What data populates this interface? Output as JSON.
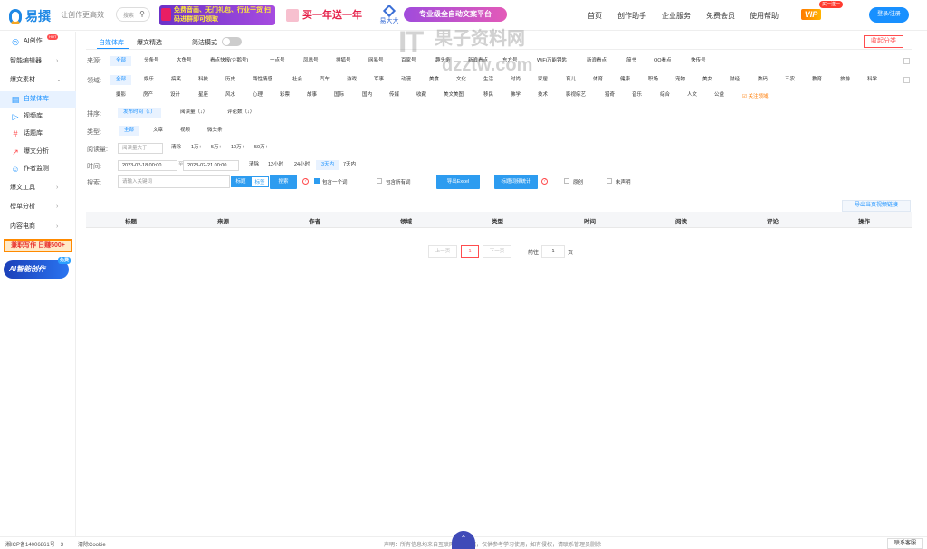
{
  "header": {
    "logo_text": "易撰",
    "slogan": "让创作更高效",
    "search_placeholder": "搜索",
    "ad_banner_1": "免费音画、无门礼包、行业干货 扫码进群即可领取",
    "ad_banner_2": "买一年送一年",
    "ad_banner_3": "易大大",
    "ad_banner_4": "专业级全自动文案平台",
    "nav": [
      "首页",
      "创作助手",
      "企业服务",
      "免费会员",
      "使用帮助"
    ],
    "vip_label": "VIP",
    "vip_badge": "买一送一",
    "login_label": "登录/注册"
  },
  "sidebar": {
    "items": [
      {
        "label": "AI创作",
        "badge": "HOT",
        "icon": "ai-icon"
      },
      {
        "label": "智能编辑器",
        "arrow": "›"
      },
      {
        "label": "爆文素材",
        "arrow": "⌄"
      },
      {
        "label": "自媒体库",
        "icon": "article-icon",
        "active": true
      },
      {
        "label": "视频库",
        "icon": "video-icon"
      },
      {
        "label": "话题库",
        "icon": "hash-icon"
      },
      {
        "label": "爆文分析",
        "icon": "chart-icon"
      },
      {
        "label": "作者监测",
        "icon": "user-monitor-icon"
      },
      {
        "label": "爆文工具",
        "arrow": "›"
      },
      {
        "label": "榜单分析",
        "arrow": "›"
      },
      {
        "label": "内容电商",
        "arrow": "›"
      }
    ],
    "promo_1": "兼职写作 日赚500+",
    "promo_2": "AI智能创作",
    "promo_2_badge": "免费"
  },
  "main": {
    "tabs": [
      "自媒体库",
      "爆文精选"
    ],
    "simple_mode_label": "简洁模式",
    "collapse_label": "收起分类",
    "filters": {
      "source_label": "来源:",
      "sources": [
        "全部",
        "头条号",
        "大鱼号",
        "看点快报(企鹅号)",
        "一点号",
        "凤凰号",
        "搜狐号",
        "网易号",
        "百家号",
        "趣头条",
        "新浪看点",
        "东方号",
        "WiFi万能钥匙",
        "新浪看点",
        "简书",
        "QQ看点",
        "快传号"
      ],
      "field_label": "领域:",
      "fields_row1": [
        "全部",
        "娱乐",
        "搞笑",
        "科技",
        "历史",
        "两性情感",
        "社会",
        "汽车",
        "游戏",
        "军事",
        "动漫",
        "美食",
        "文化",
        "生活",
        "时尚",
        "家居",
        "育儿",
        "体育",
        "健康",
        "职场",
        "宠物",
        "美女",
        "财经",
        "数码",
        "三农",
        "教育",
        "旅游",
        "科学"
      ],
      "fields_row2": [
        "摄影",
        "房产",
        "设计",
        "星座",
        "风水",
        "心理",
        "彩票",
        "故事",
        "国际",
        "国内",
        "传媒",
        "收藏",
        "美文美图",
        "移民",
        "佛学",
        "技术",
        "影视综艺",
        "猎奇",
        "音乐",
        "综合",
        "人文",
        "公益"
      ],
      "follow_label": "关注领域",
      "sort_label": "排序:",
      "sorts": [
        "发布时间（↓）",
        "阅读量（↓）",
        "评论数（↓）"
      ],
      "type_label": "类型:",
      "types": [
        "全部",
        "文章",
        "视频",
        "微头条"
      ],
      "reads_label": "阅读量:",
      "reads_placeholder": "阅读量大于",
      "reads_options": [
        "清除",
        "1万+",
        "5万+",
        "10万+",
        "50万+"
      ],
      "time_label": "时间:",
      "date_start": "2023-02-18 00:00",
      "date_sep": "至",
      "date_end": "2023-02-21 00:00",
      "time_options": [
        "清除",
        "12小时",
        "24小时",
        "3天内",
        "7天内"
      ],
      "search_label": "搜索:",
      "search_placeholder": "请输入关键词",
      "seg_title": "标题",
      "seg_label": "标签",
      "search_button": "搜索",
      "contains_one": "包含一个词",
      "contains_all": "包含所有词",
      "export_excel": "导出Excel",
      "title_stats": "标题词频统计",
      "original": "原创",
      "no_voice": "未声明"
    },
    "export_video_link": "导出当页视频链接",
    "table_headers": [
      "标题",
      "来源",
      "作者",
      "领域",
      "类型",
      "时间",
      "阅读",
      "评论",
      "操作"
    ],
    "pagination": {
      "prev": "上一页",
      "current": "1",
      "next": "下一页",
      "goto_prefix": "前往",
      "goto_value": "1",
      "goto_suffix": "页"
    }
  },
  "footer": {
    "icp": "湘ICP备14006861号－3",
    "cookie": "清除Cookie",
    "notice": "声明：所有信息均来自互联网公开数据，仅供参考学习使用，如有侵权，请联系管理员删除",
    "contact": "联系客服"
  },
  "watermark": {
    "big": "IT",
    "mid": "果子资料网",
    "small": "dzztw.com"
  }
}
